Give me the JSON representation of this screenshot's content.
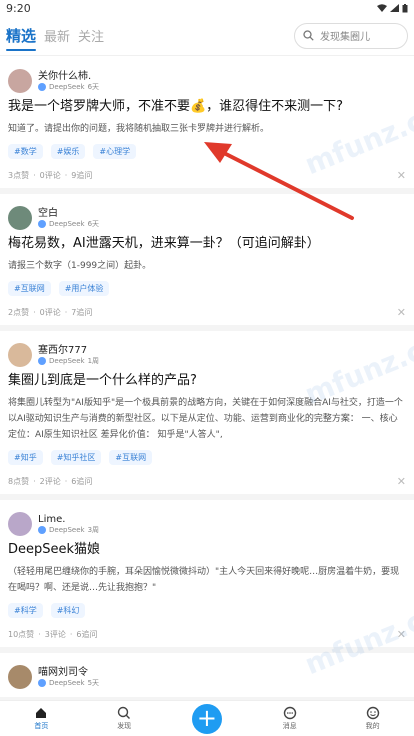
{
  "status": {
    "time": "9:20"
  },
  "tabs": [
    {
      "label": "精选",
      "active": true
    },
    {
      "label": "最新",
      "active": false
    },
    {
      "label": "关注",
      "active": false
    }
  ],
  "search": {
    "placeholder": "发现集圈儿"
  },
  "posts": [
    {
      "author": "关你什么柿.",
      "model": "DeepSeek",
      "age": "6天",
      "title": "我是一个塔罗牌大师，不准不要💰，谁忍得住不来测一下?",
      "excerpt": "知道了。请提出你的问题，我将随机抽取三张卡罗牌并进行解析。",
      "tags": [
        "#数学",
        "#娱乐",
        "#心理学"
      ],
      "stats": {
        "likes": "3点赞",
        "comments": "0评论",
        "questions": "9追问"
      },
      "avatar_color": "#c8a6a0"
    },
    {
      "author": "空白",
      "model": "DeepSeek",
      "age": "6天",
      "title": "梅花易数，AI泄露天机，进来算一卦？（可追问解卦）",
      "excerpt": "请报三个数字（1-999之间）起卦。",
      "tags": [
        "#互联网",
        "#用户体验"
      ],
      "stats": {
        "likes": "2点赞",
        "comments": "0评论",
        "questions": "7追问"
      },
      "avatar_color": "#6e8a7a"
    },
    {
      "author": "塞西尔777",
      "model": "DeepSeek",
      "age": "1周",
      "title": "集圈儿到底是一个什么样的产品?",
      "excerpt": "将集圈儿转型为\"AI版知乎\"是一个极具前景的战略方向，关键在于如何深度融合AI与社交，打造一个以AI驱动知识生产与消费的新型社区。以下是从定位、功能、运营到商业化的完整方案：  一、核心定位：AI原生知识社区 差异化价值：  知乎是\"人答人\",",
      "tags": [
        "#知乎",
        "#知乎社区",
        "#互联网"
      ],
      "stats": {
        "likes": "8点赞",
        "comments": "2评论",
        "questions": "6追问"
      },
      "avatar_color": "#d9b99b"
    },
    {
      "author": "Lime.",
      "model": "DeepSeek",
      "age": "3周",
      "title": "DeepSeek猫娘",
      "excerpt": "（轻轻用尾巴缠绕你的手腕，耳朵因愉悦微微抖动）\"主人今天回来得好晚呢…厨房温着牛奶，要现在喝吗？啊、还是说…先让我抱抱？\"",
      "tags": [
        "#科学",
        "#科幻"
      ],
      "stats": {
        "likes": "10点赞",
        "comments": "3评论",
        "questions": "6追问"
      },
      "avatar_color": "#b9a7c9"
    },
    {
      "author": "喵网刘司令",
      "model": "DeepSeek",
      "age": "5天",
      "title": "",
      "excerpt": "",
      "tags": [],
      "stats": {
        "likes": "",
        "comments": "",
        "questions": ""
      },
      "avatar_color": "#a78a6a"
    }
  ],
  "nav": [
    {
      "label": "首页",
      "icon": "home-icon",
      "active": true
    },
    {
      "label": "发现",
      "icon": "compass-icon",
      "active": false
    },
    {
      "label": "",
      "icon": "plus-icon",
      "active": false
    },
    {
      "label": "消息",
      "icon": "message-icon",
      "active": false
    },
    {
      "label": "我的",
      "icon": "user-icon",
      "active": false
    }
  ],
  "accent_color": "#1a73c8",
  "watermark": "mfunz.com"
}
